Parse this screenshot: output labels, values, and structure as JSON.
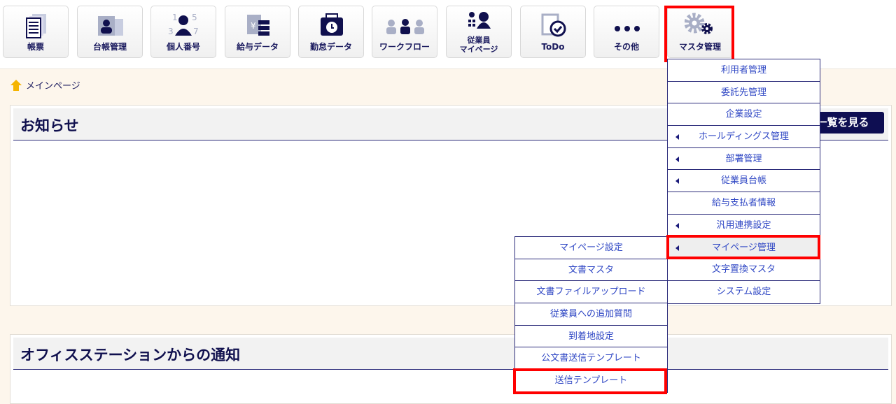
{
  "toolbar": [
    {
      "label": "帳票",
      "icon": "document-stack-icon"
    },
    {
      "label": "台帳管理",
      "icon": "id-card-icon"
    },
    {
      "label": "個人番号",
      "icon": "person-number-icon"
    },
    {
      "label": "給与データ",
      "icon": "salary-envelope-icon"
    },
    {
      "label": "勤怠データ",
      "icon": "timecard-icon"
    },
    {
      "label": "ワークフロー",
      "icon": "workflow-people-icon"
    },
    {
      "label": "従業員",
      "label2": "マイページ",
      "icon": "employee-mypage-icon"
    },
    {
      "label": "ToDo",
      "icon": "todo-check-icon"
    },
    {
      "label": "その他",
      "icon": "more-dots-icon"
    },
    {
      "label": "マスタ管理",
      "icon": "gear-icon"
    }
  ],
  "breadcrumb": {
    "label": "メインページ",
    "icon": "home-icon"
  },
  "notice": {
    "title": "お知らせ",
    "button": "一覧を見る"
  },
  "office": {
    "title": "オフィスステーションからの通知"
  },
  "master_menu": [
    {
      "label": "利用者管理",
      "sub": false
    },
    {
      "label": "委託先管理",
      "sub": false
    },
    {
      "label": "企業設定",
      "sub": false
    },
    {
      "label": "ホールディングス管理",
      "sub": true
    },
    {
      "label": "部署管理",
      "sub": true
    },
    {
      "label": "従業員台帳",
      "sub": true
    },
    {
      "label": "給与支払者情報",
      "sub": false
    },
    {
      "label": "汎用連携設定",
      "sub": true
    },
    {
      "label": "マイページ管理",
      "sub": true,
      "selected": true
    },
    {
      "label": "文字置換マスタ",
      "sub": false
    },
    {
      "label": "システム設定",
      "sub": false
    }
  ],
  "mypage_menu": [
    "マイページ設定",
    "文書マスタ",
    "文書ファイルアップロード",
    "従業員への追加質問",
    "到着地設定",
    "公文書送信テンプレート",
    "送信テンプレート"
  ],
  "colors": {
    "navy": "#1a1a5e",
    "link": "#2f47c4",
    "highlight": "#ff0000",
    "bg": "#fdf6ec"
  }
}
